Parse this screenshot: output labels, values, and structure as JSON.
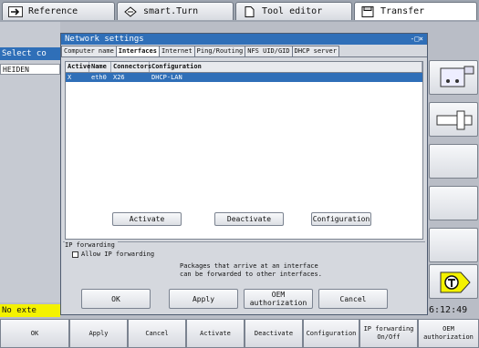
{
  "top_tabs": [
    {
      "label": "Reference",
      "icon": "arrow-right-icon"
    },
    {
      "label": "smart.Turn",
      "icon": "diamond-arrows-icon"
    },
    {
      "label": "Tool editor",
      "icon": "document-icon"
    },
    {
      "label": "Transfer",
      "icon": "floppy-icon"
    }
  ],
  "background": {
    "select_strip": "Select co",
    "heiden_label": "HEIDEN",
    "no_ext": "No exte",
    "clock": "6:12:49"
  },
  "dialog": {
    "title": "Network settings",
    "controls": "-□×",
    "tabs": [
      "Computer name",
      "Interfaces",
      "Internet",
      "Ping/Routing",
      "NFS UID/GID",
      "DHCP server"
    ],
    "active_tab": "Interfaces",
    "table": {
      "headers": [
        "Active",
        "Name",
        "Connectors",
        "Configuration"
      ],
      "rows": [
        {
          "active": "X",
          "name": "eth0",
          "connectors": "X26",
          "configuration": "DHCP-LAN"
        }
      ]
    },
    "actions": {
      "activate": "Activate",
      "deactivate": "Deactivate",
      "configuration": "Configuration"
    },
    "ip_forwarding": {
      "title": "IP forwarding",
      "checkbox_label": "Allow IP forwarding",
      "hint_line1": "Packages that arrive at an interface",
      "hint_line2": "can be forwarded to other interfaces."
    },
    "buttons": {
      "ok": "OK",
      "apply": "Apply",
      "oem_line1": "OEM",
      "oem_line2": "authorization",
      "cancel": "Cancel"
    }
  },
  "softkeys": [
    {
      "l1": "OK",
      "l2": ""
    },
    {
      "l1": "Apply",
      "l2": ""
    },
    {
      "l1": "Cancel",
      "l2": ""
    },
    {
      "l1": "Activate",
      "l2": ""
    },
    {
      "l1": "Deactivate",
      "l2": ""
    },
    {
      "l1": "Configuration",
      "l2": ""
    },
    {
      "l1": "IP forwarding",
      "l2": "On/Off"
    },
    {
      "l1": "OEM",
      "l2": "authorization"
    }
  ],
  "colors": {
    "accent": "#2f6fb8",
    "warning": "#f4f200"
  }
}
